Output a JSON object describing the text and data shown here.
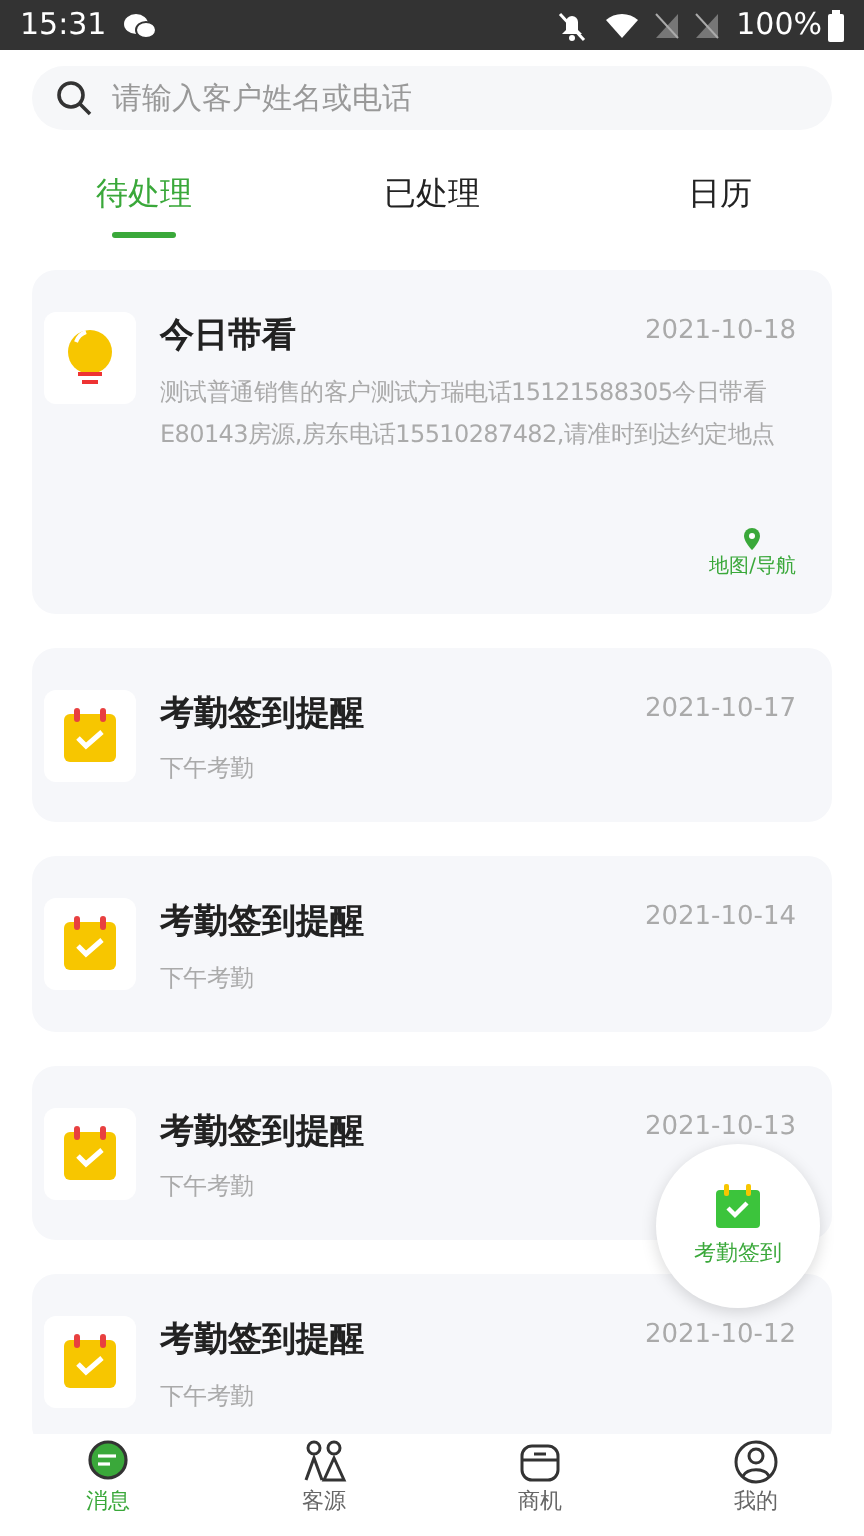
{
  "status_bar": {
    "time": "15:31",
    "battery": "100%"
  },
  "search": {
    "placeholder": "请输入客户姓名或电话"
  },
  "tabs": [
    {
      "label": "待处理",
      "selected": true
    },
    {
      "label": "已处理",
      "selected": false
    },
    {
      "label": "日历",
      "selected": false
    }
  ],
  "messages": [
    {
      "kind": "lightbulb",
      "title": "今日带看",
      "date": "2021-10-18",
      "body": "测试普通销售的客户测试方瑞电话15121588305今日带看E80143房源,房东电话15510287482,请准时到达约定地点",
      "action": "地图/导航"
    },
    {
      "kind": "calendar",
      "title": "考勤签到提醒",
      "date": "2021-10-17",
      "body": "下午考勤"
    },
    {
      "kind": "calendar",
      "title": "考勤签到提醒",
      "date": "2021-10-14",
      "body": "下午考勤"
    },
    {
      "kind": "calendar",
      "title": "考勤签到提醒",
      "date": "2021-10-13",
      "body": "下午考勤"
    },
    {
      "kind": "calendar",
      "title": "考勤签到提醒",
      "date": "2021-10-12",
      "body": "下午考勤"
    }
  ],
  "fab": {
    "label": "考勤签到"
  },
  "bottom_nav": [
    {
      "label": "消息",
      "selected": true,
      "kind": "message"
    },
    {
      "label": "客源",
      "selected": false,
      "kind": "people"
    },
    {
      "label": "商机",
      "selected": false,
      "kind": "box"
    },
    {
      "label": "我的",
      "selected": false,
      "kind": "user"
    }
  ]
}
